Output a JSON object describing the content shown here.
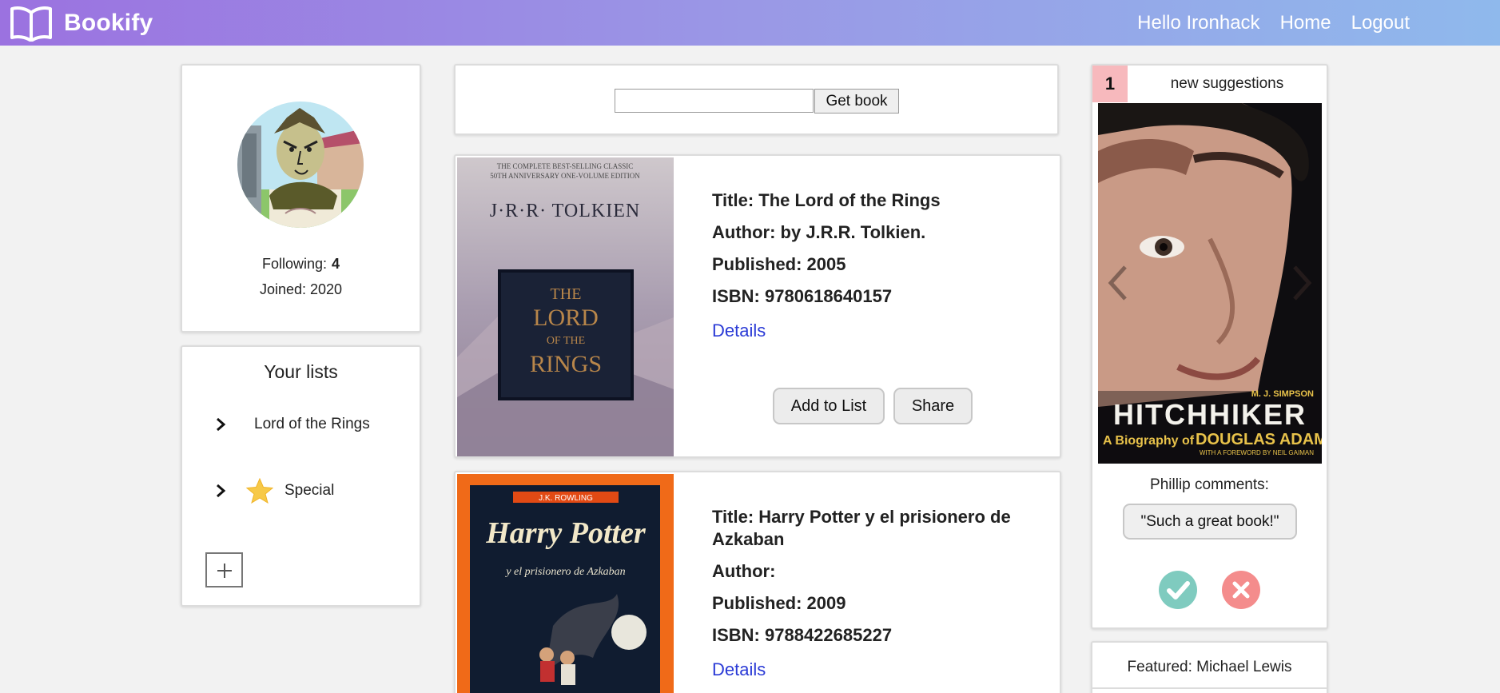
{
  "navbar": {
    "brand": "Bookify",
    "brand_icon": "open-book-icon",
    "links": [
      "Hello Ironhack",
      "Home",
      "Logout"
    ],
    "gradient": [
      "#9b72e0",
      "#8fb9ec"
    ]
  },
  "profile": {
    "following_label": "Following:",
    "following_count": "4",
    "joined": "Joined: 2020"
  },
  "lists": {
    "title": "Your lists",
    "items": [
      {
        "label": "Lord of the Rings",
        "icon": null
      },
      {
        "label": "Special",
        "icon": "star-icon"
      }
    ],
    "add_icon": "plus-icon"
  },
  "search": {
    "value": "",
    "button": "Get book"
  },
  "books": [
    {
      "title": "Title: The Lord of the Rings",
      "author": "Author: by J.R.R. Tolkien.",
      "published": "Published: 2005",
      "isbn": "ISBN: 9780618640157",
      "details": "Details",
      "add_button": "Add to List",
      "share_button": "Share",
      "cover": {
        "top_text": "THE COMPLETE BEST-SELLING CLASSIC",
        "sub_text": "50TH ANNIVERSARY ONE-VOLUME EDITION",
        "author_text": "J·R·R· TOLKIEN",
        "title_lines": [
          "THE",
          "LORD",
          "OF THE",
          "RINGS"
        ]
      }
    },
    {
      "title": "Title: Harry Potter y el prisionero de Azkaban",
      "author": "Author:",
      "published": "Published: 2009",
      "isbn": "ISBN: 9788422685227",
      "details": "Details",
      "cover": {
        "author_text": "J.K. ROWLING",
        "title_line": "Harry Potter",
        "subtitle": "y el prisionero de Azkaban"
      }
    }
  ],
  "suggestions": {
    "count": "1",
    "label": "new suggestions",
    "cover": {
      "author_text": "M. J. SIMPSON",
      "title_text": "HITCHHIKER",
      "subtitle_prefix": "A Biography of",
      "subtitle_name": "DOUGLAS ADAMS",
      "foreword": "WITH A FOREWORD BY NEIL GAIMAN"
    },
    "comment_label": "Phillip comments:",
    "comment": "\"Such a great book!\"",
    "accept_icon": "check-icon",
    "reject_icon": "x-icon",
    "accept_color": "#7fcbbf",
    "reject_color": "#f48c8c",
    "badge_color": "#f7b9bd"
  },
  "featured": {
    "title": "Featured: Michael Lewis"
  }
}
